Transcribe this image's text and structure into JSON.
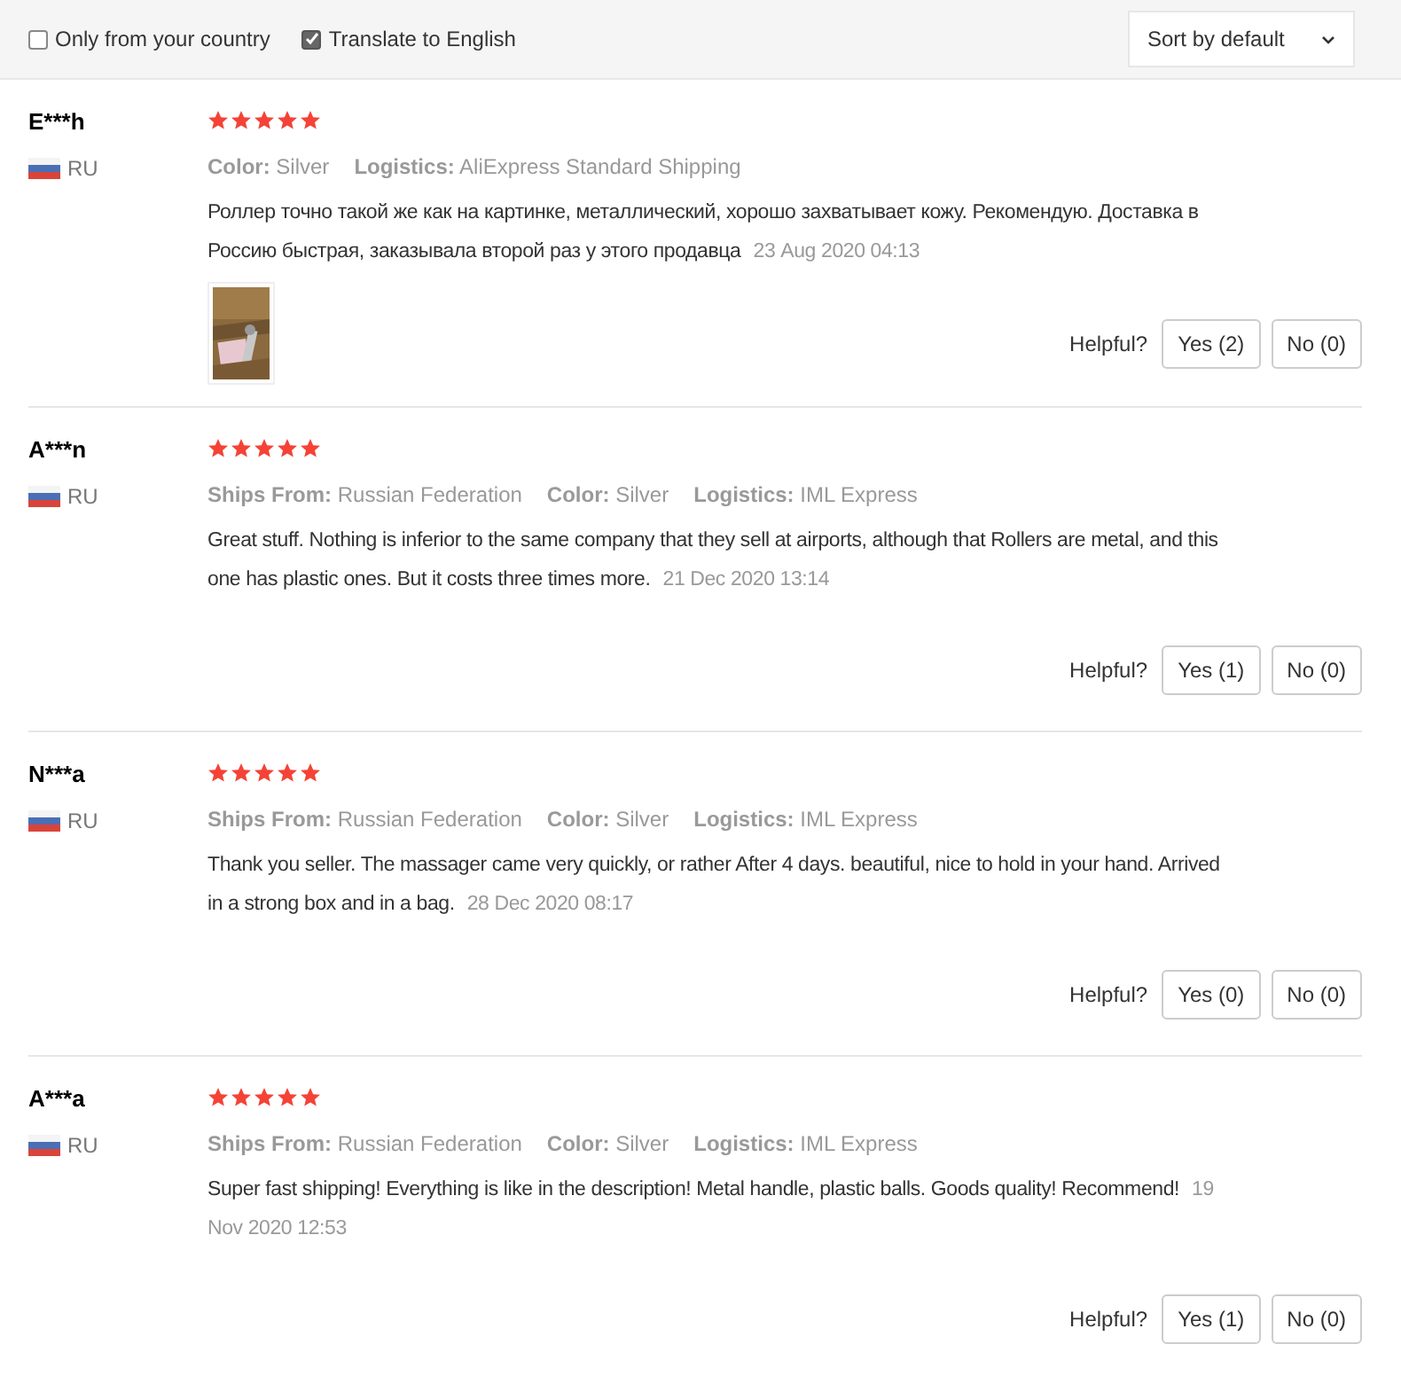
{
  "filters": [
    {
      "label": "Only from your country",
      "checked": false
    },
    {
      "label": "Translate to English",
      "checked": true
    }
  ],
  "sort": {
    "value": "Sort by default"
  },
  "reviews": [
    {
      "author": "E***h",
      "country": "RU",
      "stars": 5,
      "attributes": [
        {
          "label": "Color:",
          "value": "Silver"
        },
        {
          "label": "Logistics:",
          "value": "AliExpress Standard Shipping"
        }
      ],
      "text": "Роллер точно такой же как на картинке, металлический, хорошо захватывает кожу. Рекомендую. Доставка в Россию быстрая, заказывала второй раз у этого продавца",
      "date": "23 Aug 2020 04:13",
      "photos": [
        {
          "kind": "picture"
        }
      ],
      "helpful_label": "Helpful?",
      "yes": "Yes (2)",
      "no": "No (0)"
    },
    {
      "author": "A***n",
      "country": "RU",
      "stars": 5,
      "attributes": [
        {
          "label": "Ships From:",
          "value": "Russian Federation"
        },
        {
          "label": "Color:",
          "value": "Silver"
        },
        {
          "label": "Logistics:",
          "value": "IML Express"
        }
      ],
      "text": "Great stuff. Nothing is inferior to the same company that they sell at airports, although that Rollers are metal, and this one has plastic ones. But it costs three times more.",
      "date": "21 Dec 2020 13:14",
      "helpful_label": "Helpful?",
      "yes": "Yes (1)",
      "no": "No (0)"
    },
    {
      "author": "N***a",
      "country": "RU",
      "stars": 5,
      "attributes": [
        {
          "label": "Ships From:",
          "value": "Russian Federation"
        },
        {
          "label": "Color:",
          "value": "Silver"
        },
        {
          "label": "Logistics:",
          "value": "IML Express"
        }
      ],
      "text": "Thank you seller. The massager came very quickly, or rather After 4 days. beautiful, nice to hold in your hand. Arrived in a strong box and in a bag.",
      "date": "28 Dec 2020 08:17",
      "helpful_label": "Helpful?",
      "yes": "Yes (0)",
      "no": "No (0)"
    },
    {
      "author": "A***a",
      "country": "RU",
      "stars": 5,
      "attributes": [
        {
          "label": "Ships From:",
          "value": "Russian Federation"
        },
        {
          "label": "Color:",
          "value": "Silver"
        },
        {
          "label": "Logistics:",
          "value": "IML Express"
        }
      ],
      "text": "Super fast shipping! Everything is like in the description! Metal handle, plastic balls. Goods quality! Recommend!",
      "date": "19 Nov 2020 12:53",
      "helpful_label": "Helpful?",
      "yes": "Yes (1)",
      "no": "No (0)"
    }
  ]
}
